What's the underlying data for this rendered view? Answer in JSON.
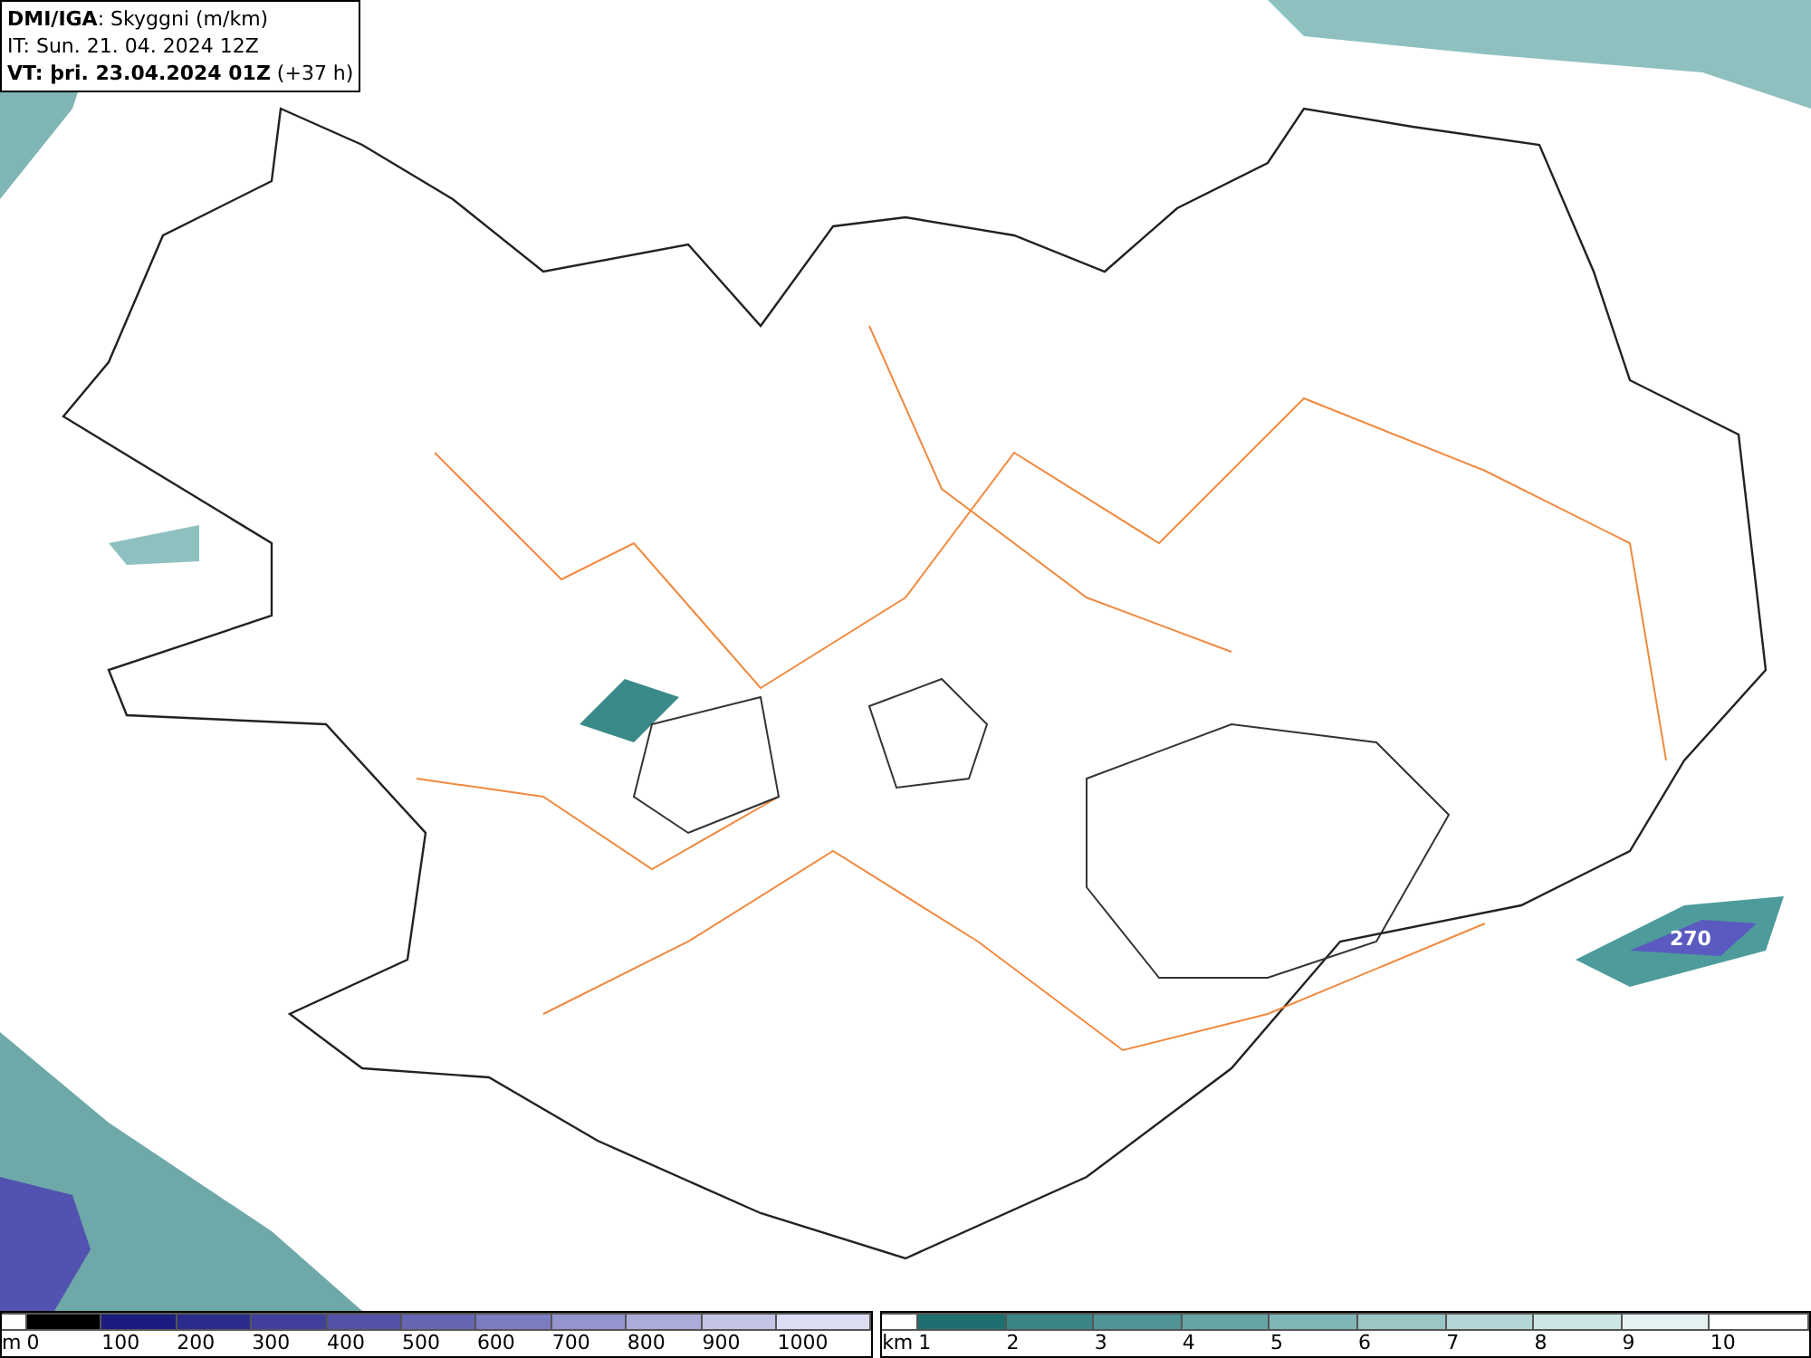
{
  "header": {
    "lines": [
      "**DMI/IGA**: Skyggni (m/km)",
      "IT: Sun. 21. 04. 2024 12Z",
      "**VT: þri. 23.04.2024 01Z** (+37 h)"
    ]
  },
  "map": {
    "value_label": "270"
  },
  "legends": [
    {
      "unit": "m",
      "stops": [
        {
          "label": "0",
          "color": "#000000"
        },
        {
          "label": "100",
          "color": "#1c1c80"
        },
        {
          "label": "200",
          "color": "#2c2c8c"
        },
        {
          "label": "300",
          "color": "#40409c"
        },
        {
          "label": "400",
          "color": "#5252a8"
        },
        {
          "label": "500",
          "color": "#6666b4"
        },
        {
          "label": "600",
          "color": "#7c7cc2"
        },
        {
          "label": "700",
          "color": "#9494ce"
        },
        {
          "label": "800",
          "color": "#acacda"
        },
        {
          "label": "900",
          "color": "#c4c4e6"
        },
        {
          "label": "1000",
          "color": "#dcdcf2"
        }
      ]
    },
    {
      "unit": "km",
      "stops": [
        {
          "label": "1",
          "color": "#1e7070"
        },
        {
          "label": "2",
          "color": "#3a8585"
        },
        {
          "label": "3",
          "color": "#509595"
        },
        {
          "label": "4",
          "color": "#66a5a5"
        },
        {
          "label": "5",
          "color": "#80b6b6"
        },
        {
          "label": "6",
          "color": "#9ac6c6"
        },
        {
          "label": "7",
          "color": "#b4d6d6"
        },
        {
          "label": "8",
          "color": "#cde5e5"
        },
        {
          "label": "9",
          "color": "#e4f1f1"
        },
        {
          "label": "10",
          "color": "#ffffff"
        }
      ]
    }
  ]
}
